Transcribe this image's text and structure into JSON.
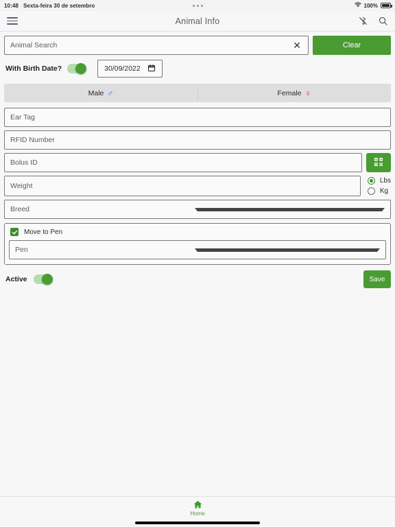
{
  "status_bar": {
    "time": "10:48",
    "date": "Sexta-feira 30 de setembro",
    "battery_percent": "100%",
    "wifi_icon": "wifi-icon",
    "battery_icon": "battery-full-icon",
    "dots_icon": "recording-dots-icon"
  },
  "app_bar": {
    "menu_icon": "hamburger-menu-icon",
    "title": "Animal Info",
    "bluetooth_icon": "bluetooth-disabled-icon",
    "search_icon": "search-icon"
  },
  "search": {
    "placeholder": "Animal Search",
    "value": "",
    "clear_x_icon": "close-x-icon",
    "clear_button_label": "Clear"
  },
  "birth_date": {
    "label": "With Birth Date?",
    "toggle_on": true,
    "date_value": "30/09/2022",
    "calendar_icon": "calendar-icon"
  },
  "gender_tabs": [
    {
      "label": "Male",
      "symbol": "♂",
      "color": "#1a73e8"
    },
    {
      "label": "Female",
      "symbol": "♀",
      "color": "#e5156c"
    }
  ],
  "fields": {
    "ear_tag": {
      "placeholder": "Ear Tag",
      "value": ""
    },
    "rfid_number": {
      "placeholder": "RFID Number",
      "value": ""
    },
    "bolus_id": {
      "placeholder": "Bolus ID",
      "value": "",
      "scan_icon": "qr-code-icon"
    },
    "weight": {
      "placeholder": "Weight",
      "value": ""
    }
  },
  "weight_units": {
    "options": [
      {
        "label": "Lbs",
        "selected": true
      },
      {
        "label": "Kg",
        "selected": false
      }
    ]
  },
  "breed": {
    "label": "Breed",
    "caret_icon": "chevron-down-icon"
  },
  "move_to_pen": {
    "checkbox_label": "Move to Pen",
    "checked": true,
    "check_icon": "check-icon",
    "pen_label": "Pen",
    "caret_icon": "chevron-down-icon"
  },
  "active": {
    "label": "Active",
    "toggle_on": true,
    "save_label": "Save"
  },
  "bottom_nav": {
    "items": [
      {
        "label": "Home",
        "icon": "home-icon",
        "active": true
      }
    ]
  },
  "colors": {
    "accent_green": "#4a9b32",
    "light_green": "#b5ddab",
    "male_blue": "#1a73e8",
    "female_pink": "#e5156c",
    "tab_background": "#dedede"
  }
}
